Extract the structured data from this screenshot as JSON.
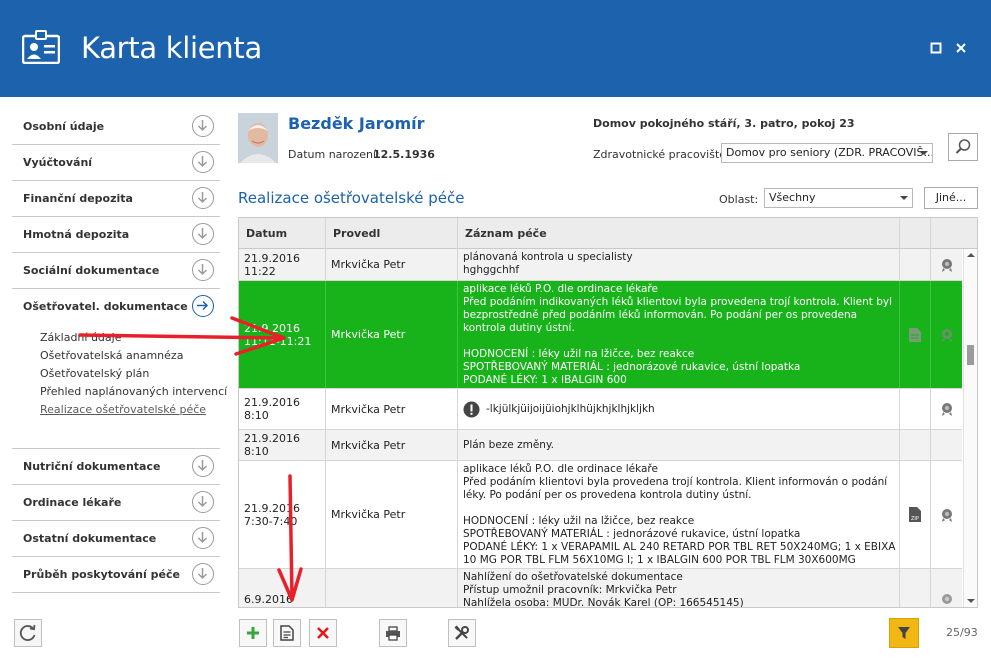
{
  "window": {
    "title": "Karta klienta",
    "maximize_icon": "maximize-icon",
    "close_icon": "close-icon"
  },
  "sidebar": {
    "items": [
      {
        "label": "Osobní údaje"
      },
      {
        "label": "Vyúčtování"
      },
      {
        "label": "Finanční depozita"
      },
      {
        "label": "Hmotná depozita"
      },
      {
        "label": "Sociální dokumentace"
      },
      {
        "label": "Ošetřovatel. dokumentace"
      },
      {
        "label": "Nutriční dokumentace"
      },
      {
        "label": "Ordinace lékaře"
      },
      {
        "label": "Ostatní dokumentace"
      },
      {
        "label": "Průběh poskytování péče"
      }
    ],
    "subitems": [
      {
        "label": "Základní údaje"
      },
      {
        "label": "Ošetřovatelská anamnéza"
      },
      {
        "label": "Ošetřovatelský plán"
      },
      {
        "label": "Přehled naplánovaných intervencí"
      },
      {
        "label": "Realizace ošetřovatelské péče"
      }
    ]
  },
  "patient": {
    "name": "Bezděk Jaromír",
    "dob_label": "Datum narození:",
    "dob_value": "12.5.1936",
    "facility": "Domov pokojného stáří, 3. patro, pokoj 23",
    "workplace_label": "Zdravotnické pracoviště:",
    "workplace_value": "Domov pro seniory (ZDR. PRACOVIŠ..."
  },
  "section": {
    "title": "Realizace ošetřovatelské péče",
    "area_label": "Oblast:",
    "area_value": "Všechny",
    "other_button": "Jiné..."
  },
  "grid": {
    "headers": [
      "Datum",
      "Provedl",
      "Záznam péče"
    ],
    "rows": [
      {
        "date": "21.9.2016\n11:22",
        "who": "Mrkvička Petr",
        "record": "plánovaná kontrola u specialisty\nhghggchhf",
        "doc_icon": "",
        "sig_icon": "seal-icon"
      },
      {
        "date": "21.9.2016\n11:11-11:21",
        "who": "Mrkvička Petr",
        "record": "aplikace léků P.O. dle ordinace lékaře\nPřed podáním indikovaných léků klientovi byla provedena trojí kontrola. Klient byl bezprostředně před podáním léků informován. Po podání per os provedena kontrola dutiny ústní.\n\nHODNOCENÍ : léky užil na lžičce, bez reakce\nSPOTŘEBOVANÝ MATERIÁL : jednorázové rukavice, ústní lopatka\nPODANÉ LÉKY: 1 x IBALGIN 600",
        "doc_icon": "document-icon",
        "sig_icon": "seal-icon"
      },
      {
        "date": "21.9.2016\n8:10",
        "who": "Mrkvička Petr",
        "record": "-lkjülkjüijoijüiohjklhüjkhjklhjkljkh",
        "doc_icon": "",
        "sig_icon": "seal-icon",
        "warning": true
      },
      {
        "date": "21.9.2016\n8:10",
        "who": "Mrkvička Petr",
        "record": "Plán beze změny.",
        "doc_icon": "",
        "sig_icon": ""
      },
      {
        "date": "21.9.2016\n7:30-7:40",
        "who": "Mrkvička Petr",
        "record": "aplikace léků P.O. dle ordinace lékaře\nPřed podáním klientovi byla provedena trojí kontrola. Klient informován o podání léky. Po podání per os provedena kontrola dutiny ústní.\n\nHODNOCENÍ : léky užil na lžičce, bez reakce\nSPOTŘEBOVANÝ MATERIÁL : jednorázové rukavice, ústní lopatka\nPODANÉ LÉKY: 1 x VERAPAMIL AL 240 RETARD POR TBL RET 50X240MG; 1 x EBIXA 10 MG POR TBL FLM 56X10MG I; 1 x IBALGIN 600 POR TBL FLM 30X600MG",
        "doc_icon": "zip-document-icon",
        "sig_icon": "seal-icon"
      },
      {
        "date": "6.9.2016",
        "who": "",
        "record": "Nahlížení do ošetřovatelské dokumentace\nPřístup umožnil pracovník: Mrkvička Petr\nNahlížela osoba: MUDr. Novák Karel (OP: 166545145)",
        "doc_icon": "",
        "sig_icon": "seal-icon"
      }
    ]
  },
  "toolbar": {
    "add_icon": "plus-icon",
    "edit_icon": "edit-document-icon",
    "delete_icon": "delete-icon",
    "print_icon": "printer-icon",
    "tools_icon": "tools-icon",
    "filter_icon": "filter-icon",
    "refresh_icon": "refresh-icon",
    "counter": "25/93"
  },
  "colors": {
    "brand": "#1c62ad",
    "selected_row": "#18b31a",
    "filter_button": "#f3b714",
    "annotation_arrow": "#e8202a"
  }
}
